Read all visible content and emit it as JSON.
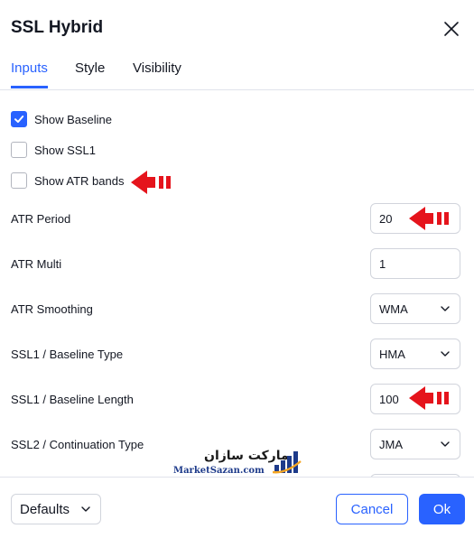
{
  "dialog": {
    "title": "SSL Hybrid",
    "close_icon": "close-icon"
  },
  "tabs": [
    {
      "label": "Inputs",
      "active": true
    },
    {
      "label": "Style",
      "active": false
    },
    {
      "label": "Visibility",
      "active": false
    }
  ],
  "checkboxes": [
    {
      "label": "Show Baseline",
      "checked": true
    },
    {
      "label": "Show SSL1",
      "checked": false
    },
    {
      "label": "Show ATR bands",
      "checked": false
    }
  ],
  "fields": {
    "atr_period": {
      "label": "ATR Period",
      "value": "20"
    },
    "atr_multi": {
      "label": "ATR Multi",
      "value": "1"
    },
    "atr_smoothing": {
      "label": "ATR Smoothing",
      "value": "WMA"
    },
    "ssl1_baseline_type": {
      "label": "SSL1 / Baseline Type",
      "value": "HMA"
    },
    "ssl1_baseline_length": {
      "label": "SSL1 / Baseline Length",
      "value": "100"
    },
    "ssl2_continuation_type": {
      "label": "SSL2 / Continuation Type",
      "value": "JMA"
    }
  },
  "watermark": {
    "text_fa": "مارکت سازان",
    "text_en": "MarketSazan.com"
  },
  "footer": {
    "defaults_label": "Defaults",
    "cancel_label": "Cancel",
    "ok_label": "Ok"
  },
  "colors": {
    "accent": "#2962ff",
    "annotation_arrow": "#e5141c",
    "border": "#d1d4dc",
    "text": "#131722"
  }
}
